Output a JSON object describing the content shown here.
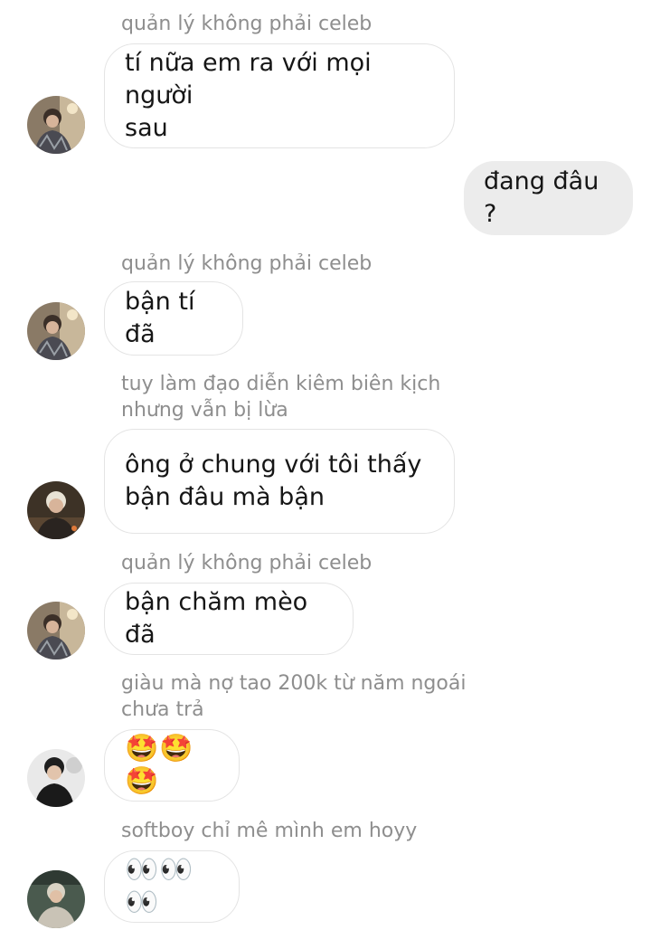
{
  "messages": [
    {
      "sender": "quản lý không phải celeb",
      "text": "tí nữa em ra với mọi người\nsau",
      "avatar": "avatar-manager"
    },
    {
      "outgoing": true,
      "text": "đang đâu ?"
    },
    {
      "sender": "quản lý không phải celeb",
      "text": "bận tí đã",
      "avatar": "avatar-manager"
    },
    {
      "sender": "tuy làm đạo diễn kiêm biên kịch\nnhưng vẫn bị lừa",
      "text": "ông ở chung với tôi thấy\nbận đâu mà bận",
      "avatar": "avatar-director"
    },
    {
      "sender": "quản lý không phải celeb",
      "text": "bận chăm mèo đã",
      "avatar": "avatar-manager"
    },
    {
      "sender": "giàu mà nợ tao 200k từ năm ngoái\nchưa trả",
      "text": "🤩🤩🤩",
      "avatar": "avatar-rich"
    },
    {
      "sender": "softboy chỉ mê mình em hoyy",
      "text": "👀👀👀",
      "avatar": "avatar-softboy"
    }
  ],
  "colors": {
    "incoming_bubble": "#ffffff",
    "incoming_border": "#e4e4e4",
    "outgoing_bubble": "#ececec",
    "sender_text": "#8e8e8e",
    "message_text": "#161616"
  }
}
